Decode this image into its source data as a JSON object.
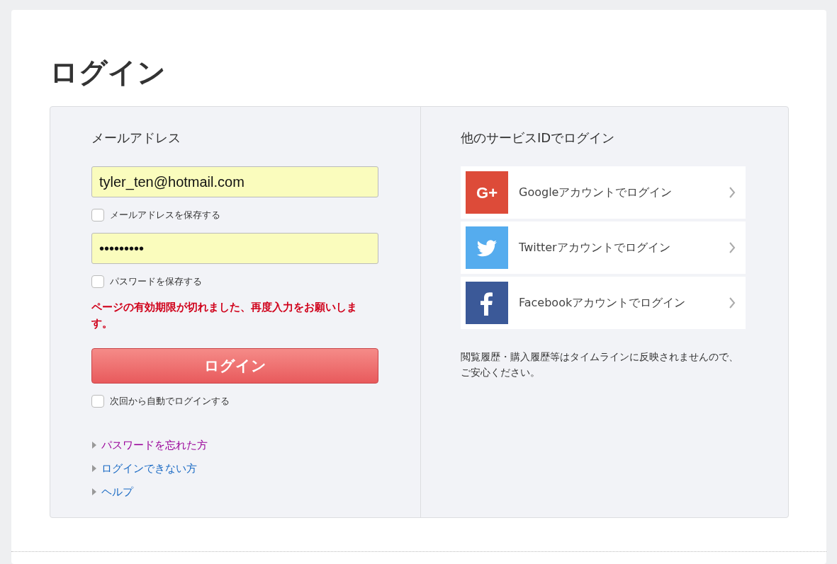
{
  "title": "ログイン",
  "login_form": {
    "email_label": "メールアドレス",
    "email_field": {
      "value": "tyler_ten@hotmail.com"
    },
    "save_email": {
      "label": "メールアドレスを保存する",
      "checked": false
    },
    "password_field": {
      "value": "•••••••••"
    },
    "save_password": {
      "label": "パスワードを保存する",
      "checked": false
    },
    "error_message": "ページの有効期限が切れました、再度入力をお願いします。",
    "login_button": "ログイン",
    "auto_login": {
      "label": "次回から自動でログインする",
      "checked": false
    },
    "links": [
      {
        "label": "パスワードを忘れた方",
        "visited": true
      },
      {
        "label": "ログインできない方",
        "visited": false
      },
      {
        "label": "ヘルプ",
        "visited": false
      }
    ]
  },
  "social_login": {
    "heading": "他のサービスIDでログイン",
    "services": [
      {
        "kind": "google",
        "color": "#dd4b39",
        "icon_text": "G+",
        "label": "Googleアカウントでログイン"
      },
      {
        "kind": "twitter",
        "color": "#55acee",
        "label": "Twitterアカウントでログイン"
      },
      {
        "kind": "facebook",
        "color": "#3b5998",
        "label": "Facebookアカウントでログイン"
      }
    ],
    "note": "閲覧履歴・購入履歴等はタイムラインに反映されませんので、ご安心ください。"
  }
}
